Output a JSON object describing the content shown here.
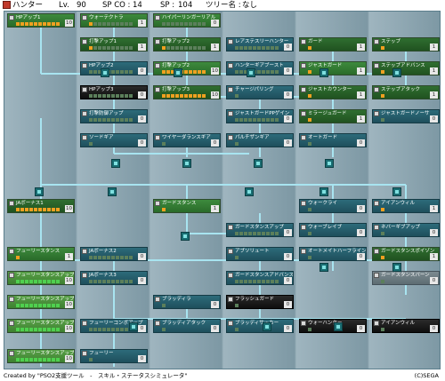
{
  "header": {
    "class_name": "ハンター",
    "lv_label": "Lv.",
    "lv_value": "90",
    "spco_label": "SP CO :",
    "spco_value": "14",
    "sp_label": "SP :",
    "sp_value": "104",
    "tree_label": "ツリー名 :",
    "tree_value": "なし"
  },
  "footer": {
    "credit": "Created by \"PSO2支援ツール　-　スキル・ステータスシミュレータ\"",
    "copyright": "(C)SEGA"
  },
  "colors": {
    "orange_pip": "#f0a020",
    "green_pip": "#4fd04f",
    "line": "#a8e4f0",
    "bg_column": "#7d98a4"
  },
  "nodes": [
    {
      "id": "n1",
      "name": "HPアップ1",
      "style": "green",
      "icon": "hp-icon",
      "filled": 10,
      "max": 10,
      "lv": "10"
    },
    {
      "id": "n2",
      "name": "ウォーテクトラ",
      "style": "green",
      "icon": "guard-icon",
      "filled": 1,
      "max": 10,
      "lv": "1"
    },
    {
      "id": "n3",
      "name": "ハイパーリンガーリアル",
      "style": "green",
      "icon": "attack-icon",
      "filled": 0,
      "max": 10,
      "lv": "0"
    },
    {
      "id": "n4",
      "name": "打撃アップ1",
      "style": "dgreen",
      "icon": "attack-icon",
      "filled": 1,
      "max": 10,
      "lv": "1"
    },
    {
      "id": "n5",
      "name": "打撃アップ2",
      "style": "dgreen",
      "icon": "attack-icon",
      "filled": 1,
      "max": 10,
      "lv": "1"
    },
    {
      "id": "n6",
      "name": "レアステスリーハンター",
      "style": "teal",
      "icon": "rare-icon",
      "filled": 0,
      "max": 10,
      "lv": "0"
    },
    {
      "id": "n7",
      "name": "ガード",
      "style": "dgreen",
      "icon": "guard-icon",
      "filled": 1,
      "max": 1,
      "lv": "1"
    },
    {
      "id": "n8",
      "name": "ステップ",
      "style": "dgreen",
      "icon": "step-icon",
      "filled": 1,
      "max": 1,
      "lv": "1"
    },
    {
      "id": "n9",
      "name": "HPアップ2",
      "style": "teal",
      "icon": "hp-icon",
      "filled": 0,
      "max": 10,
      "lv": "0"
    },
    {
      "id": "n10",
      "name": "打撃アップ2",
      "style": "green",
      "icon": "attack-icon",
      "filled": 10,
      "max": 10,
      "lv": "10"
    },
    {
      "id": "n11",
      "name": "ハンターギアブースト",
      "style": "teal",
      "icon": "gear-icon",
      "filled": 0,
      "max": 10,
      "lv": "0"
    },
    {
      "id": "n12",
      "name": "ジャストガード",
      "style": "green",
      "icon": "guard-icon",
      "filled": 1,
      "max": 1,
      "lv": "1"
    },
    {
      "id": "n13",
      "name": "ステップアドバンス",
      "style": "dgreen",
      "icon": "step-icon",
      "filled": 1,
      "max": 1,
      "lv": "1"
    },
    {
      "id": "n14",
      "name": "HPアップ3",
      "style": "black",
      "icon": "hp-icon",
      "filled": 0,
      "max": 10,
      "lv": "0"
    },
    {
      "id": "n15",
      "name": "打撃アップ3",
      "style": "dgreen",
      "icon": "attack-icon",
      "filled": 10,
      "max": 10,
      "lv": "10"
    },
    {
      "id": "n16",
      "name": "チャージパリング",
      "style": "teal",
      "icon": "parry-icon",
      "filled": 0,
      "max": 1,
      "lv": "0"
    },
    {
      "id": "n17",
      "name": "ジャストカウンター",
      "style": "dgreen",
      "icon": "counter-icon",
      "filled": 1,
      "max": 1,
      "lv": "1"
    },
    {
      "id": "n18",
      "name": "ステップアタック",
      "style": "dgreen",
      "icon": "step-icon",
      "filled": 1,
      "max": 1,
      "lv": "1"
    },
    {
      "id": "n19",
      "name": "打撃防御アップ",
      "style": "teal",
      "icon": "defense-icon",
      "filled": 0,
      "max": 10,
      "lv": "0"
    },
    {
      "id": "n20",
      "name": "ジャストガードPPゲイン",
      "style": "teal",
      "icon": "pp-icon",
      "filled": 0,
      "max": 10,
      "lv": "0"
    },
    {
      "id": "n21",
      "name": "ミラージュガード",
      "style": "dgreen",
      "icon": "guard-icon",
      "filled": 1,
      "max": 1,
      "lv": "1"
    },
    {
      "id": "n22",
      "name": "ジャストガードノーサ",
      "style": "teal",
      "icon": "guard-icon",
      "filled": 0,
      "max": 1,
      "lv": "0"
    },
    {
      "id": "n23",
      "name": "ソードギア",
      "style": "teal",
      "icon": "sword-icon",
      "filled": 0,
      "max": 1,
      "lv": "0"
    },
    {
      "id": "n24",
      "name": "ワイヤーダランスギア",
      "style": "teal",
      "icon": "wire-icon",
      "filled": 0,
      "max": 1,
      "lv": "0"
    },
    {
      "id": "n25",
      "name": "パルチザンギア",
      "style": "teal",
      "icon": "partisan-icon",
      "filled": 0,
      "max": 1,
      "lv": "0"
    },
    {
      "id": "n26",
      "name": "オートガード",
      "style": "teal",
      "icon": "guard-icon",
      "filled": 0,
      "max": 1,
      "lv": "0"
    },
    {
      "id": "n27",
      "name": "JAボーナス1",
      "style": "dgreen",
      "icon": "ja-icon",
      "filled": 10,
      "max": 10,
      "lv": "10"
    },
    {
      "id": "n28",
      "name": "ガードスタンス",
      "style": "green",
      "icon": "stance-icon",
      "filled": 1,
      "max": 1,
      "lv": "1"
    },
    {
      "id": "n29",
      "name": "ウォークライ",
      "style": "teal",
      "icon": "cry-icon",
      "filled": 0,
      "max": 1,
      "lv": "0"
    },
    {
      "id": "n30",
      "name": "アイアンウィル",
      "style": "teal",
      "icon": "will-icon",
      "filled": 1,
      "max": 1,
      "lv": "1"
    },
    {
      "id": "n31",
      "name": "ガードスタンスアップ",
      "style": "teal",
      "icon": "stance-icon",
      "filled": 0,
      "max": 10,
      "lv": "0"
    },
    {
      "id": "n32",
      "name": "ウォーブレイブ",
      "style": "teal",
      "icon": "brave-icon",
      "filled": 0,
      "max": 1,
      "lv": "0"
    },
    {
      "id": "n33",
      "name": "ネバーギブアップ",
      "style": "teal",
      "icon": "never-icon",
      "filled": 0,
      "max": 1,
      "lv": "0"
    },
    {
      "id": "n34",
      "name": "フューリースタンス",
      "style": "green",
      "icon": "fury-icon",
      "filled": 1,
      "max": 1,
      "lv": "1"
    },
    {
      "id": "n35",
      "name": "JAボーナス2",
      "style": "teal",
      "icon": "ja-icon",
      "filled": 0,
      "max": 10,
      "lv": "0"
    },
    {
      "id": "n36",
      "name": "アブソリュート",
      "style": "teal",
      "icon": "absorb-icon",
      "filled": 0,
      "max": 1,
      "lv": "0"
    },
    {
      "id": "n37",
      "name": "オートメイトハーフライン",
      "style": "teal",
      "icon": "automate-icon",
      "filled": 0,
      "max": 1,
      "lv": "0"
    },
    {
      "id": "n38",
      "name": "ガードスタンスポイゾン",
      "style": "dgreen",
      "icon": "poison-icon",
      "filled": 1,
      "max": 1,
      "lv": "1"
    },
    {
      "id": "n39",
      "name": "フューリースタンスアップ",
      "style": "lime",
      "icon": "fury-icon",
      "filled": 10,
      "max": 10,
      "lv": "10"
    },
    {
      "id": "n40",
      "name": "JAボーナス3",
      "style": "teal",
      "icon": "ja-icon",
      "filled": 0,
      "max": 10,
      "lv": "0"
    },
    {
      "id": "n41",
      "name": "ガードスタンスアドバンス",
      "style": "teal",
      "icon": "stance-icon",
      "filled": 0,
      "max": 10,
      "lv": "0"
    },
    {
      "id": "n42",
      "name": "ガードスタンスバーン",
      "style": "gray",
      "icon": "burn-icon",
      "filled": 0,
      "max": 1,
      "lv": "0"
    },
    {
      "id": "n43",
      "name": "フューリースタンスアップ",
      "style": "lime",
      "icon": "fury-icon",
      "filled": 10,
      "max": 10,
      "lv": "10"
    },
    {
      "id": "n44",
      "name": "ブラッディラ",
      "style": "teal",
      "icon": "bloody-icon",
      "filled": 0,
      "max": 1,
      "lv": "0"
    },
    {
      "id": "n45",
      "name": "フラッシュガード",
      "style": "black",
      "icon": "flash-icon",
      "filled": 0,
      "max": 1,
      "lv": "0"
    },
    {
      "id": "n46",
      "name": "フューリースタンスアップ",
      "style": "lime",
      "icon": "fury-icon",
      "filled": 10,
      "max": 10,
      "lv": "10"
    },
    {
      "id": "n47",
      "name": "フューリーコンボアップ",
      "style": "teal",
      "icon": "combo-icon",
      "filled": 0,
      "max": 10,
      "lv": "0"
    },
    {
      "id": "n48",
      "name": "ブラッディアタック",
      "style": "teal",
      "icon": "bloody-icon",
      "filled": 0,
      "max": 1,
      "lv": "0"
    },
    {
      "id": "n49",
      "name": "ブラッディサッカー",
      "style": "teal",
      "icon": "bloody-icon",
      "filled": 0,
      "max": 1,
      "lv": "0"
    },
    {
      "id": "n50",
      "name": "ウォーハンター",
      "style": "black",
      "icon": "war-icon",
      "filled": 0,
      "max": 1,
      "lv": "0"
    },
    {
      "id": "n51",
      "name": "アイアンウィル",
      "style": "black",
      "icon": "will-icon",
      "filled": 0,
      "max": 1,
      "lv": "0"
    },
    {
      "id": "n52",
      "name": "フューリースタンスアップ",
      "style": "lime",
      "icon": "fury-icon",
      "filled": 10,
      "max": 10,
      "lv": "10"
    },
    {
      "id": "n53",
      "name": "フューリー",
      "style": "teal",
      "icon": "fury-icon",
      "filled": 0,
      "max": 1,
      "lv": "0"
    }
  ]
}
